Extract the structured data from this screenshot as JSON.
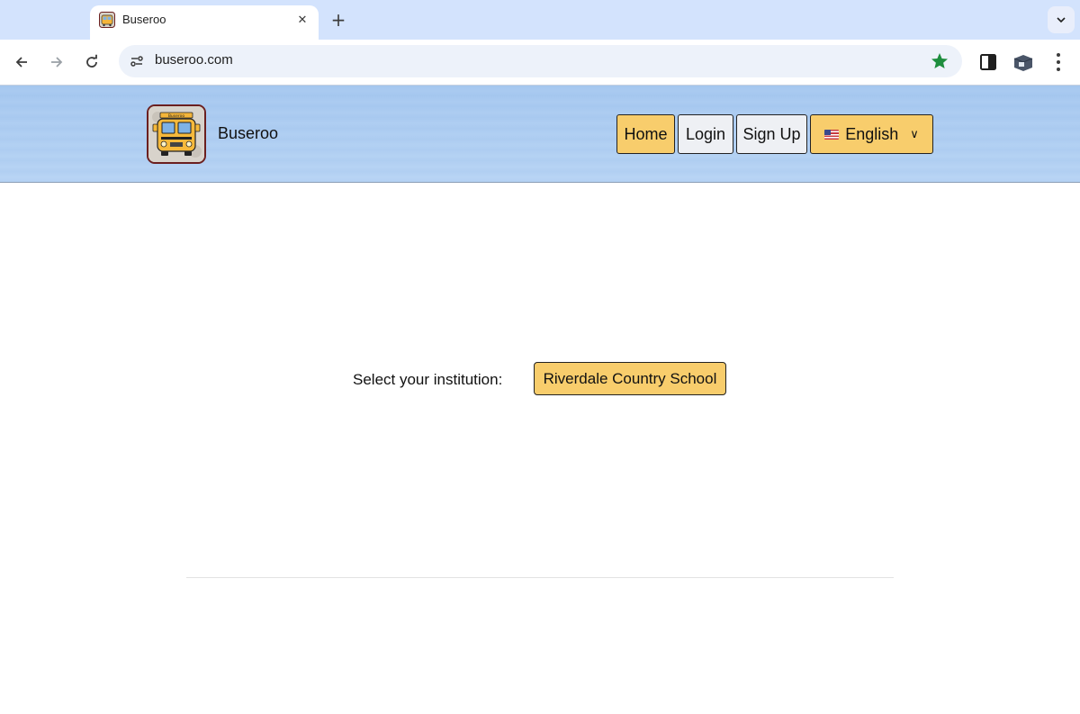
{
  "browser": {
    "tab_title": "Buseroo",
    "url": "buseroo.com"
  },
  "site": {
    "brand_name": "Buseroo",
    "logo_text": "Buseroo",
    "nav": {
      "home": "Home",
      "login": "Login",
      "signup": "Sign Up",
      "language": "English"
    }
  },
  "main": {
    "select_label": "Select your institution:",
    "institution": "Riverdale Country School"
  },
  "colors": {
    "accent_yellow": "#f8cd6c",
    "header_blue": "#a9c9ef",
    "tabstrip": "#d3e3fd",
    "star_green": "#1e8e3e"
  },
  "icons": [
    "back-arrow-icon",
    "forward-arrow-icon",
    "reload-icon",
    "site-info-icon",
    "star-icon",
    "side-panel-icon",
    "extension-icon",
    "more-vert-icon",
    "close-icon",
    "plus-icon",
    "chevron-down-icon",
    "flag-us-icon"
  ]
}
